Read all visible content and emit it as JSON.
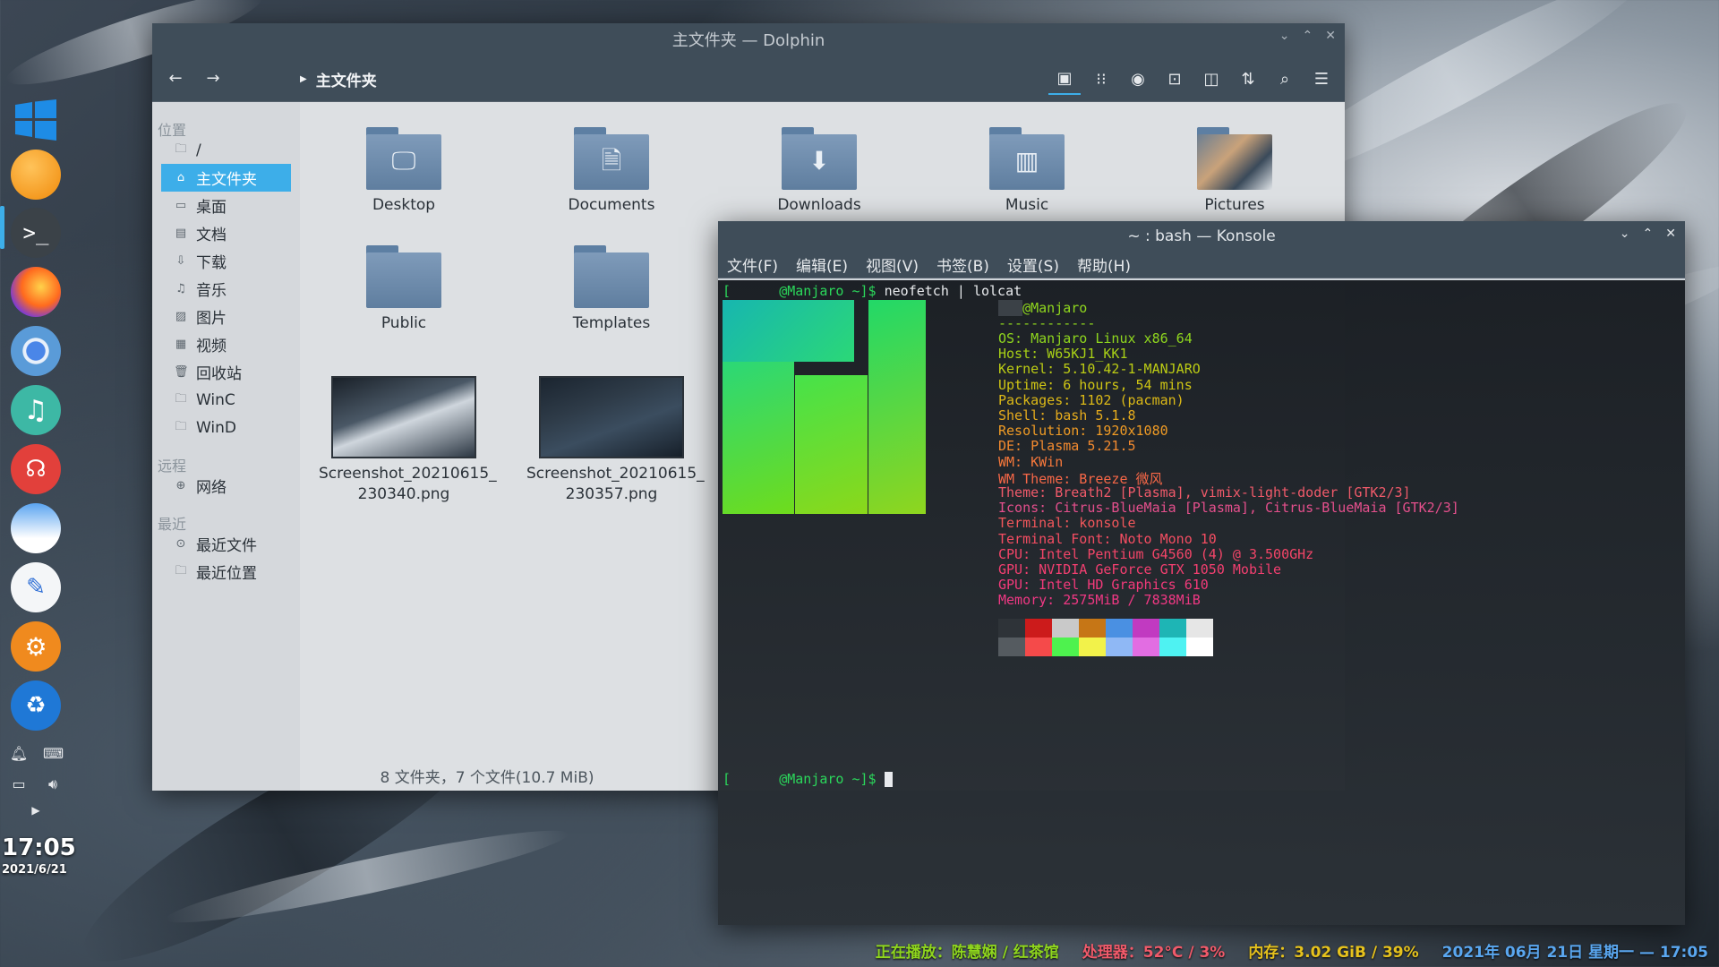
{
  "dock": {
    "items": [
      "windows-start",
      "files",
      "terminal",
      "firefox",
      "chromium",
      "music-player",
      "podcast-player",
      "photo-viewer",
      "text-editor",
      "settings",
      "recycle"
    ],
    "clock": "17:05",
    "date": "2021/6/21"
  },
  "dolphin": {
    "title": "主文件夹 — Dolphin",
    "breadcrumb": "主文件夹",
    "sidebar": {
      "section_places": "位置",
      "places": [
        {
          "icon": "folder-icon",
          "label": "/"
        },
        {
          "icon": "home-icon",
          "label": "主文件夹"
        },
        {
          "icon": "desktop-icon",
          "label": "桌面"
        },
        {
          "icon": "document-icon",
          "label": "文档"
        },
        {
          "icon": "download-icon",
          "label": "下载"
        },
        {
          "icon": "music-icon",
          "label": "音乐"
        },
        {
          "icon": "image-icon",
          "label": "图片"
        },
        {
          "icon": "video-icon",
          "label": "视频"
        },
        {
          "icon": "trash-icon",
          "label": "回收站"
        },
        {
          "icon": "folder-icon",
          "label": "WinC"
        },
        {
          "icon": "folder-icon",
          "label": "WinD"
        }
      ],
      "section_remote": "远程",
      "remote": [
        {
          "icon": "network-icon",
          "label": "网络"
        }
      ],
      "section_recent": "最近",
      "recent": [
        {
          "icon": "recent-files-icon",
          "label": "最近文件"
        },
        {
          "icon": "recent-locations-icon",
          "label": "最近位置"
        }
      ]
    },
    "files": [
      {
        "name": "Desktop",
        "type": "folder",
        "glyph": "desktop"
      },
      {
        "name": "Documents",
        "type": "folder",
        "glyph": "documents"
      },
      {
        "name": "Downloads",
        "type": "folder",
        "glyph": "downloads"
      },
      {
        "name": "Music",
        "type": "folder",
        "glyph": "music"
      },
      {
        "name": "Pictures",
        "type": "folder",
        "glyph": "pictures"
      },
      {
        "name": "Public",
        "type": "folder",
        "glyph": "none"
      },
      {
        "name": "Templates",
        "type": "folder",
        "glyph": "none"
      },
      {
        "name_line1": "Screenshot_20210615_",
        "name_line2": "230340.png",
        "type": "image"
      },
      {
        "name_line1": "Screenshot_20210615_",
        "name_line2": "230357.png",
        "type": "image"
      }
    ],
    "status": "8 文件夹，7 个文件(10.7 MiB)"
  },
  "konsole": {
    "title": "~ : bash — Konsole",
    "menu": [
      "文件(F)",
      "编辑(E)",
      "视图(V)",
      "书签(B)",
      "设置(S)",
      "帮助(H)"
    ],
    "prompt_user": "@Manjaro ~]$",
    "command": "neofetch | lolcat",
    "info_header": "@Manjaro",
    "info_rule": "------------",
    "info": [
      {
        "text": "OS: Manjaro Linux x86_64",
        "color": "#8fd61e"
      },
      {
        "text": "Host: W65KJ1_KK1",
        "color": "#a7cf17"
      },
      {
        "text": "Kernel: 5.10.42-1-MANJARO",
        "color": "#bccc14"
      },
      {
        "text": "Uptime: 6 hours, 54 mins",
        "color": "#cfc514"
      },
      {
        "text": "Packages: 1102 (pacman)",
        "color": "#dcb917"
      },
      {
        "text": "Shell: bash 5.1.8",
        "color": "#e6ab1d"
      },
      {
        "text": "Resolution: 1920x1080",
        "color": "#ef9b25"
      },
      {
        "text": "DE: Plasma 5.21.5",
        "color": "#f38a2f"
      },
      {
        "text": "WM: KWin",
        "color": "#f6783b"
      },
      {
        "text": "WM Theme: Breeze 微风",
        "color": "#f76747"
      },
      {
        "text": "Theme: Breath2 [Plasma], vimix-light-doder [GTK2/3]",
        "color": "#f05a6a"
      },
      {
        "text": "Icons: Citrus-BlueMaia [Plasma], Citrus-BlueMaia [GTK2/3]",
        "color": "#e44f8c"
      },
      {
        "text": "Terminal: konsole",
        "color": "#f2575b"
      },
      {
        "text": "Terminal Font: Noto Mono 10",
        "color": "#f54d62"
      },
      {
        "text": "CPU: Intel Pentium G4560 (4) @ 3.500GHz",
        "color": "#f44568"
      },
      {
        "text": "GPU: NVIDIA GeForce GTX 1050 Mobile",
        "color": "#f33f70"
      },
      {
        "text": "GPU: Intel HD Graphics 610",
        "color": "#f23a7a"
      },
      {
        "text": "Memory: 2575MiB / 7838MiB",
        "color": "#f03884"
      }
    ],
    "palette_top": [
      "#2e3338",
      "#cc1b1b",
      "#c9c9c9",
      "#c67616",
      "#4a90e2",
      "#c13ac1",
      "#1eb5b5",
      "#e6e6e6"
    ],
    "palette_bottom": [
      "#555b60",
      "#f54a4a",
      "#4ef24e",
      "#f2f24a",
      "#8fb8f5",
      "#e26de2",
      "#4ef2f2",
      "#ffffff"
    ]
  },
  "panel": {
    "music": "正在播放：陈慧娴 / 红茶馆",
    "music_color": "#8fd61e",
    "cpu": "处理器：52°C / 3%",
    "cpu_color": "#f05a6a",
    "mem": "内存：3.02 GiB / 39%",
    "mem_color": "#e6c21d",
    "datetime": "2021年 06月 21日 星期一 — 17:05",
    "datetime_color": "#5aa7f0"
  }
}
